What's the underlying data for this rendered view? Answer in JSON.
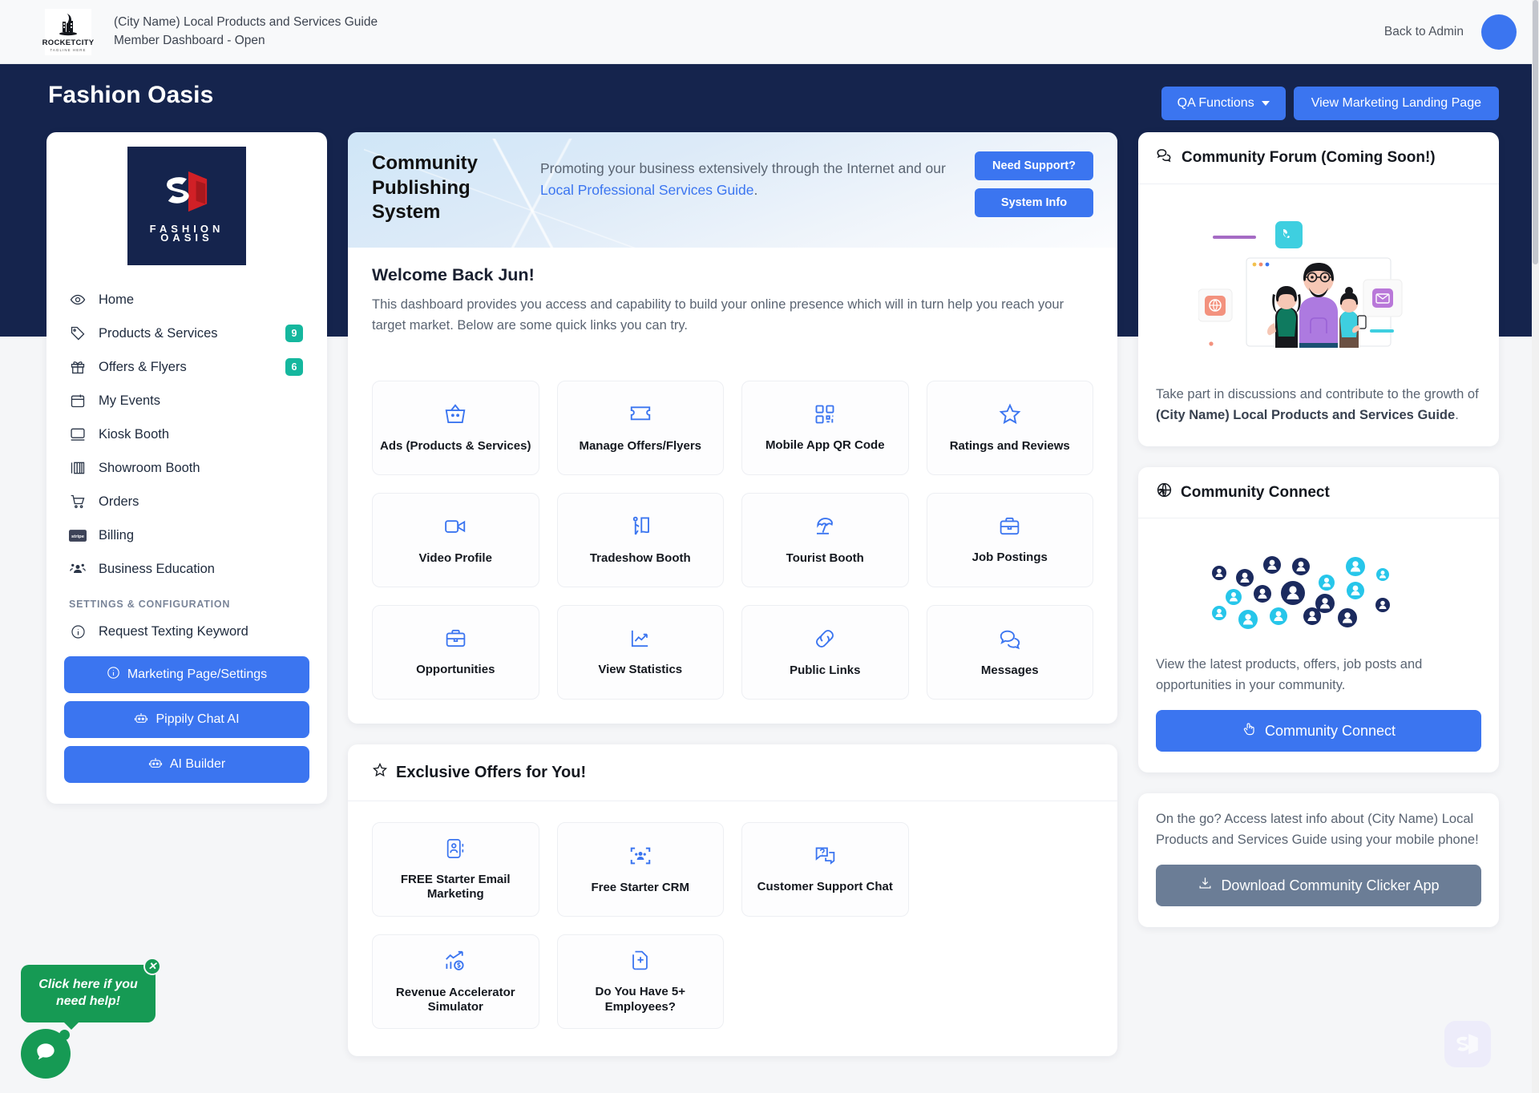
{
  "topbar": {
    "logo_name": "ROCKETCITY",
    "logo_tagline": "TAGLINE HERE",
    "title_line1": "(City Name) Local Products and Services Guide",
    "title_line2": "Member Dashboard - Open",
    "back_to_admin": "Back to Admin",
    "avatar_color": "#3b75f0"
  },
  "hero": {
    "business_name": "Fashion Oasis",
    "qa_functions_label": "QA Functions",
    "view_landing_label": "View Marketing Landing Page",
    "background_color": "#15244d"
  },
  "sidebar": {
    "logo_line1": "FASHION",
    "logo_line2": "OASIS",
    "items": [
      {
        "label": "Home",
        "icon": "eye-icon",
        "badge": null
      },
      {
        "label": "Products & Services",
        "icon": "tag-icon",
        "badge": "9"
      },
      {
        "label": "Offers & Flyers",
        "icon": "gift-icon",
        "badge": "6"
      },
      {
        "label": "My Events",
        "icon": "calendar-icon",
        "badge": null
      },
      {
        "label": "Kiosk Booth",
        "icon": "monitor-icon",
        "badge": null
      },
      {
        "label": "Showroom Booth",
        "icon": "showroom-icon",
        "badge": null
      },
      {
        "label": "Orders",
        "icon": "cart-icon",
        "badge": null
      },
      {
        "label": "Billing",
        "icon": "stripe-icon",
        "badge": null
      },
      {
        "label": "Business Education",
        "icon": "people-icon",
        "badge": null
      }
    ],
    "section_label": "SETTINGS & CONFIGURATION",
    "settings_items": [
      {
        "label": "Request Texting Keyword",
        "icon": "info-circle-icon"
      }
    ],
    "buttons": [
      {
        "label": "Marketing Page/Settings",
        "icon": "info-circle-icon"
      },
      {
        "label": "Pippily Chat AI",
        "icon": "robot-icon"
      },
      {
        "label": "AI Builder",
        "icon": "robot-icon"
      }
    ],
    "badge_color": "#15b79e",
    "button_color": "#3b75f0"
  },
  "promo": {
    "title": "Community Publishing System",
    "text_before": "Promoting your business extensively through the Internet and our ",
    "link_text": "Local Professional Services Guide",
    "text_after": ".",
    "support_button": "Need Support?",
    "system_info_button": "System Info"
  },
  "welcome": {
    "heading": "Welcome Back Jun!",
    "body": "This dashboard provides you access and capability to build your online presence which will in turn help you reach your target market. Below are some quick links you can try."
  },
  "quick_links": [
    {
      "label": "Ads (Products & Services)",
      "icon": "basket-icon"
    },
    {
      "label": "Manage Offers/Flyers",
      "icon": "ticket-icon"
    },
    {
      "label": "Mobile App QR Code",
      "icon": "qr-code-icon"
    },
    {
      "label": "Ratings and Reviews",
      "icon": "star-icon"
    },
    {
      "label": "Video Profile",
      "icon": "video-camera-icon"
    },
    {
      "label": "Tradeshow Booth",
      "icon": "tradeshow-icon"
    },
    {
      "label": "Tourist Booth",
      "icon": "umbrella-icon"
    },
    {
      "label": "Job Postings",
      "icon": "briefcase-icon"
    },
    {
      "label": "Opportunities",
      "icon": "briefcase-icon"
    },
    {
      "label": "View Statistics",
      "icon": "chart-line-icon"
    },
    {
      "label": "Public Links",
      "icon": "link-icon"
    },
    {
      "label": "Messages",
      "icon": "chat-bubbles-icon"
    }
  ],
  "offers": {
    "heading": "Exclusive Offers for You!",
    "heading_icon": "star-icon",
    "items": [
      {
        "label": "FREE Starter Email Marketing",
        "icon": "contact-card-icon"
      },
      {
        "label": "Free Starter CRM",
        "icon": "crm-scan-icon"
      },
      {
        "label": "Customer Support Chat",
        "icon": "question-chat-icon"
      },
      {
        "label": "Revenue Accelerator Simulator",
        "icon": "revenue-chart-icon"
      },
      {
        "label": "Do You Have 5+ Employees?",
        "icon": "document-plus-icon"
      }
    ]
  },
  "forum_card": {
    "title": "Community Forum (Coming Soon!)",
    "title_icon": "chat-bubbles-icon",
    "text_before": "Take part in discussions and contribute to the growth of ",
    "text_bold": "(City Name) Local Products and Services Guide",
    "text_after": "."
  },
  "connect_card": {
    "title": "Community Connect",
    "title_icon": "globe-arrow-icon",
    "text": "View the latest products, offers, job posts and opportunities in your community.",
    "button_label": "Community Connect",
    "button_icon": "pointer-hand-icon"
  },
  "mobile_card": {
    "text": "On the go? Access latest info about (City Name) Local Products and Services Guide using your mobile phone!",
    "button_label": "Download Community Clicker App",
    "button_icon": "download-icon",
    "button_color": "#6b7d96"
  },
  "chat_widget": {
    "bubble_text": "Click here if you need help!",
    "close_label": "✕",
    "color": "#169a54"
  }
}
